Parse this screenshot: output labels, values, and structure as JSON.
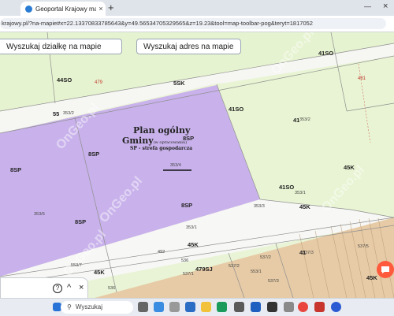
{
  "browser": {
    "tab_title": "Geoportal Krajowy mapy i inform",
    "tab_close": "×",
    "new_tab": "+",
    "minimize": "—",
    "close": "×",
    "url": "krajowy.pl/?na-mapie#x=22.13370833785643&y=49.56534705329565&z=19.23&tool=map-toolbar-pog&teryt=1817052"
  },
  "map": {
    "search_parcel_button": "Wyszukaj działkę na mapie",
    "search_address_button": "Wyszukaj adres na mapie",
    "plan": {
      "title": "Plan ogólny",
      "subtitle": "Gminy",
      "subtitle_note": "(w opracowaniu)",
      "zone_code": "8SP",
      "zone_desc": "SP - strefa gospodarcza"
    },
    "labels": {
      "l1": "44SO",
      "l2": "479",
      "l3": "5SK",
      "l4": "55",
      "l5": "353/2",
      "l6": "41SO",
      "l7": "481",
      "l8": "41SO",
      "l9": "41",
      "l10": "8SP",
      "l11": "8SP",
      "l12": "8SP",
      "l13": "353/4",
      "l14": "8SP",
      "l15": "45K",
      "l16": "41SO",
      "l17": "353/1",
      "l18": "45K",
      "l19": "353/3",
      "l20": "353/6",
      "l21": "8SP",
      "l22": "353/1",
      "l23": "45K",
      "l24": "492",
      "l25": "536",
      "l26": "479SJ",
      "l27": "537/2",
      "l28": "41",
      "l29": "537/3",
      "l30": "45K",
      "l31": "553/7",
      "l32": "537/1",
      "l33": "537/2",
      "l34": "536",
      "l35": "537/3",
      "l36": "537/5",
      "l37": "553/1",
      "l38": "45K"
    },
    "watermarks": [
      "OnGeo.pl",
      "OnGeo.pl",
      "OnGeo.pl",
      "OnGeo.pl",
      "OnGeo.pl"
    ],
    "colors": {
      "green_zone": "#e6f3d0",
      "purple_zone": "#c8b0ea",
      "road_zone": "#f7f7f5",
      "tan_zone": "#e6caa5",
      "chat_button": "#ff5a3c"
    }
  },
  "controls": {
    "help": "?",
    "collapse": "^",
    "close": "×"
  },
  "taskbar": {
    "search_placeholder": "Wyszukaj",
    "search_icon": "search-icon"
  }
}
